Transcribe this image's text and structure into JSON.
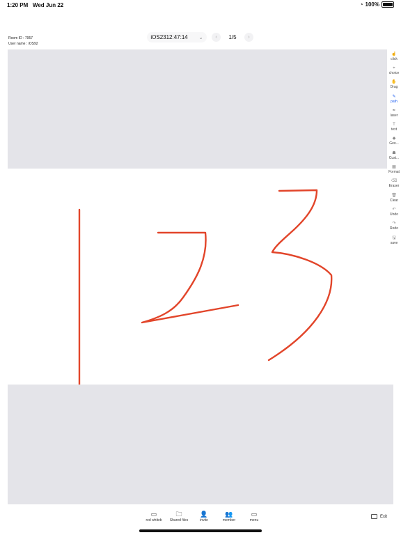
{
  "status_bar": {
    "time": "1:20 PM",
    "date": "Wed Jun 22",
    "battery": "100%"
  },
  "room_info": {
    "room_id": "Room ID : 7957",
    "user_name": "User name : iOS92"
  },
  "doc_selector": {
    "value": "iOS2312:47:14"
  },
  "pager": {
    "current": "1/5"
  },
  "toolbar": [
    {
      "label": "click",
      "icon": "cursor-icon",
      "glyph": "☝"
    },
    {
      "label": "choice",
      "icon": "selection-icon",
      "glyph": "⌖"
    },
    {
      "label": "Drag",
      "icon": "hand-icon",
      "glyph": "✋"
    },
    {
      "label": "path",
      "icon": "pencil-icon",
      "glyph": "✎"
    },
    {
      "label": "laser",
      "icon": "laser-icon",
      "glyph": "✒"
    },
    {
      "label": "text",
      "icon": "text-icon",
      "glyph": "T"
    },
    {
      "label": "Geo...",
      "icon": "shapes-icon",
      "glyph": "◆"
    },
    {
      "label": "Cust...",
      "icon": "custom-shape-icon",
      "glyph": "☗"
    },
    {
      "label": "Format",
      "icon": "format-icon",
      "glyph": "▦"
    },
    {
      "label": "Eraser",
      "icon": "eraser-icon",
      "glyph": "⌫"
    },
    {
      "label": "Clear",
      "icon": "trash-icon",
      "glyph": "🗑"
    },
    {
      "label": "Undo",
      "icon": "undo-icon",
      "glyph": "↶"
    },
    {
      "label": "Redo",
      "icon": "redo-icon",
      "glyph": "↷"
    },
    {
      "label": "save",
      "icon": "save-icon",
      "glyph": "🖫"
    }
  ],
  "active_tool": "path",
  "bottom_bar": [
    {
      "label": "red whiteb",
      "icon": "whiteboard-icon",
      "glyph": "▭"
    },
    {
      "label": "Shared files",
      "icon": "folder-icon",
      "glyph": "🗀"
    },
    {
      "label": "invite",
      "icon": "invite-icon",
      "glyph": "👤"
    },
    {
      "label": "member",
      "icon": "members-icon",
      "glyph": "👥"
    },
    {
      "label": "menu",
      "icon": "menu-icon",
      "glyph": "▭"
    }
  ],
  "exit": {
    "label": "Exit"
  },
  "colors": {
    "stroke": "#e2452a",
    "accent": "#1b5cf0",
    "board_bg": "#e4e4e9"
  }
}
